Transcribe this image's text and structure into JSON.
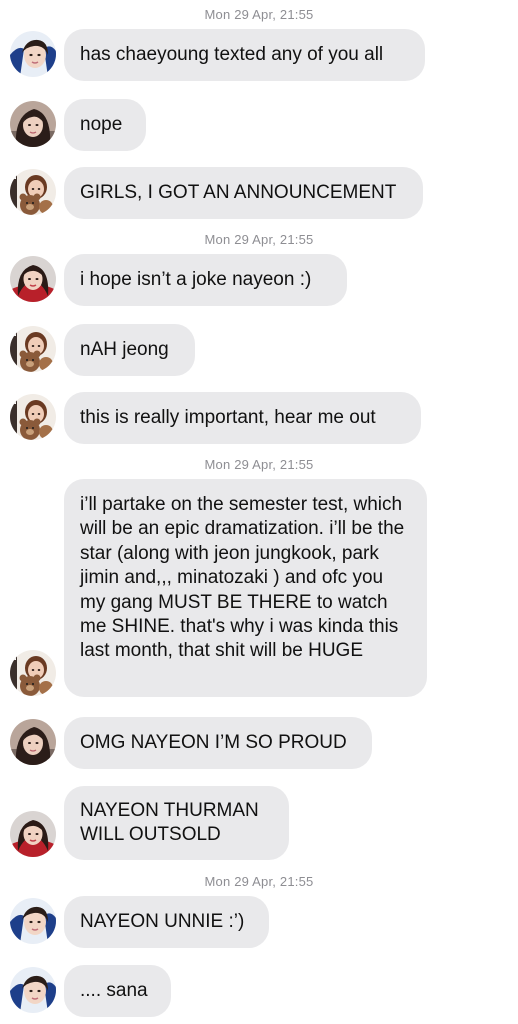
{
  "conversation": {
    "timestamps": [
      "Mon 29 Apr, 21:55",
      "Mon 29 Apr, 21:55",
      "Mon 29 Apr, 21:55",
      "Mon 29 Apr, 21:55"
    ],
    "messages": [
      {
        "avatar": "avatar-blue-hoodie-icon",
        "text": "has chaeyoung texted any of you all"
      },
      {
        "avatar": "avatar-dark-hair-icon",
        "text": "nope"
      },
      {
        "avatar": "avatar-teddy-bear-icon",
        "text": "GIRLS, I GOT AN ANNOUNCEMENT"
      },
      {
        "avatar": "avatar-red-jacket-icon",
        "text": "i hope isn’t a joke nayeon :)"
      },
      {
        "avatar": "avatar-teddy-bear-icon",
        "text": "nAH jeong"
      },
      {
        "avatar": "avatar-teddy-bear-icon",
        "text": "this is really important, hear me out"
      },
      {
        "avatar": "avatar-teddy-bear-icon",
        "text": "i’ll partake on the semester test, which will be an epic dramatization. i’ll be the star (along with jeon jungkook, park jimin and,,, minatozaki ) and ofc you my gang MUST BE THERE to watch me SHINE. that's why i was kinda this last month, that shit will be HUGE"
      },
      {
        "avatar": "avatar-dark-hair-icon",
        "text": "OMG NAYEON I’M SO PROUD"
      },
      {
        "avatar": "avatar-red-jacket-icon",
        "text": "NAYEON THURMAN WILL OUTSOLD"
      },
      {
        "avatar": "avatar-blue-hoodie-icon",
        "text": "NAYEON UNNIE :’)"
      },
      {
        "avatar": "avatar-blue-hoodie-icon",
        "text": ".... sana"
      }
    ]
  }
}
